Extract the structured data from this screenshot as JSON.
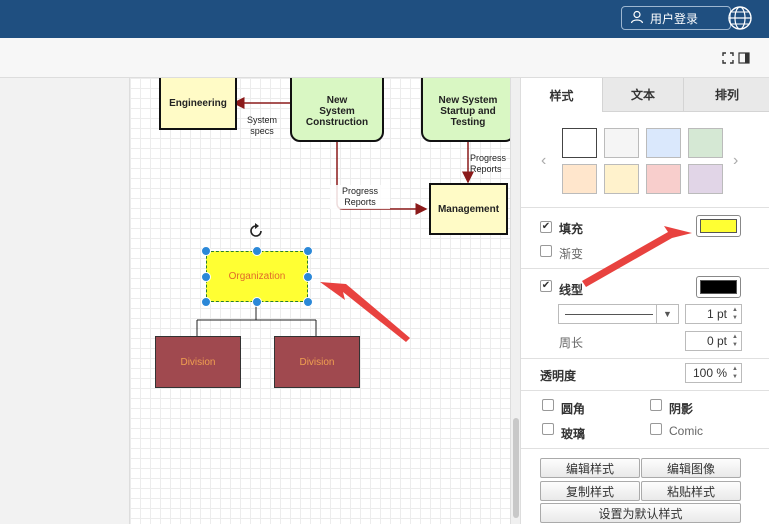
{
  "header": {
    "login_label": "用户登录",
    "icons": [
      "user-icon",
      "globe-icon"
    ],
    "bg_color": "#1f4f80"
  },
  "toolbar": {
    "icons": [
      "fit-page-icon",
      "format-panel-icon"
    ]
  },
  "diagram": {
    "nodes": {
      "engineering": "Engineering",
      "new_system_construction": "New\nSystem\nConstruction",
      "new_system_startup": "New System\nStartup and\nTesting",
      "management": "Management",
      "organization": "Organization",
      "division_left": "Division",
      "division_right": "Division"
    },
    "edge_labels": {
      "system_specs": "System\nspecs",
      "progress_reports_1": "Progress\nReports",
      "progress_reports_2": "Progress\nReports"
    },
    "colors": {
      "selected_fill": "#ffff33",
      "division_fill": "#a0494f",
      "process_fill": "#d9f7c3",
      "entity_fill": "#fffbc6",
      "edge": "#8b1a1a",
      "annotation_arrow": "#e8423f"
    }
  },
  "format_panel": {
    "tabs": [
      {
        "label": "样式",
        "active": true
      },
      {
        "label": "文本",
        "active": false
      },
      {
        "label": "排列",
        "active": false
      }
    ],
    "swatches": [
      "#ffffff",
      "#f5f5f5",
      "#dae8fc",
      "#d5e8d4",
      "#ffe6cc",
      "#fff2cc",
      "#f8cecc",
      "#e1d5e7"
    ],
    "fill": {
      "label": "填充",
      "checked": true,
      "color": "#ffff33"
    },
    "gradient": {
      "label": "渐变",
      "checked": false
    },
    "line": {
      "label": "线型",
      "checked": true,
      "color": "#000000",
      "width": "1 pt"
    },
    "perimeter": {
      "label": "周长",
      "value": "0 pt"
    },
    "opacity": {
      "label": "透明度",
      "value": "100 %"
    },
    "options": {
      "rounded": {
        "label": "圆角",
        "checked": false
      },
      "shadow": {
        "label": "阴影",
        "checked": false
      },
      "glass": {
        "label": "玻璃",
        "checked": false
      },
      "comic": {
        "label": "Comic",
        "checked": false
      }
    },
    "buttons": {
      "edit_style": "编辑样式",
      "edit_image": "编辑图像",
      "copy_style": "复制样式",
      "paste_style": "粘贴样式",
      "set_default": "设置为默认样式"
    }
  }
}
